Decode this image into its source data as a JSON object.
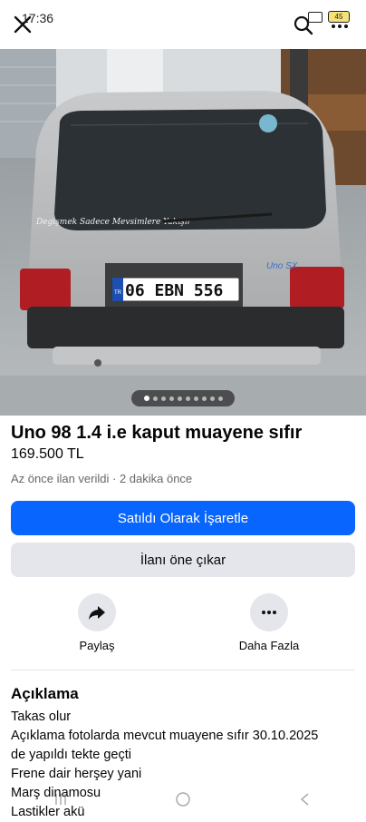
{
  "status": {
    "time": "17:36",
    "battery": "45"
  },
  "icons": {
    "close": "close-icon",
    "search": "search-icon",
    "more": "more-options-icon",
    "share": "share-arrow-icon",
    "more_dots": "more-dots-icon"
  },
  "photo": {
    "car_sticker": "Degişmek Sadece Mevsimlere Yakışır",
    "plate": "06 EBN 556",
    "plate_country": "TR",
    "badge": "Uno SX",
    "page_count": 10,
    "active_page": 0
  },
  "listing": {
    "title": "Uno 98 1.4 i.e kaput muayene sıfır",
    "price": "169.500 TL",
    "meta": "Az önce ilan verildi · 2 dakika önce"
  },
  "buttons": {
    "mark_sold": "Satıldı Olarak İşaretle",
    "boost": "İlanı öne çıkar"
  },
  "actions": {
    "share": "Paylaş",
    "more": "Daha Fazla"
  },
  "description": {
    "heading": "Açıklama",
    "lines": [
      "Takas olur",
      "Açıklama fotolarda mevcut muayene sıfır 30.10.2025",
      "de yapıldı tekte geçti",
      "Frene dair herşey yani",
      "Marş dinamosu",
      "Lastikler akü"
    ]
  },
  "colors": {
    "primary": "#0866ff",
    "secondary_bg": "#e4e6eb",
    "meta_text": "#65676b"
  }
}
